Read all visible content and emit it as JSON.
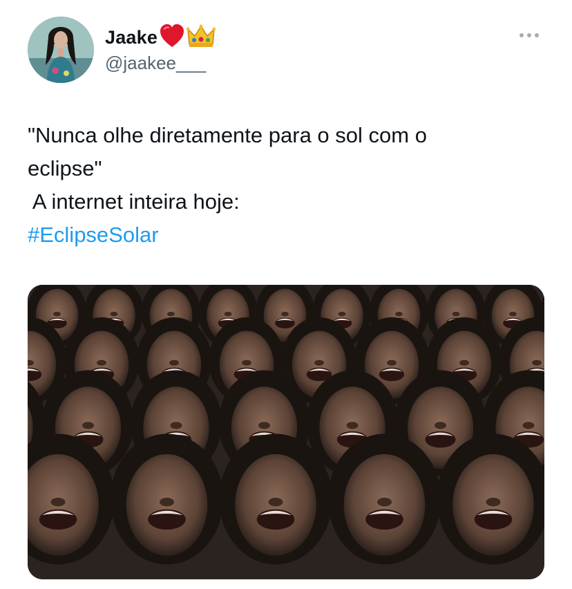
{
  "tweet": {
    "author": {
      "display_name": "Jaake",
      "handle": "@jaakee___",
      "badges": [
        "red-heart-icon",
        "crown-icon"
      ]
    },
    "more_icon": "more-horizontal-icon",
    "text_lines": [
      "\"Nunca olhe diretamente para o sol com o",
      "eclipse\"",
      " A internet inteira hoje:"
    ],
    "hashtag": "#EclipseSolar",
    "media": {
      "type": "image",
      "description_icon": "meme-image"
    }
  },
  "colors": {
    "text": "#0f1419",
    "secondary": "#536471",
    "link": "#1d9bf0",
    "heart": "#e0162b",
    "crown": "#f6c02b"
  }
}
